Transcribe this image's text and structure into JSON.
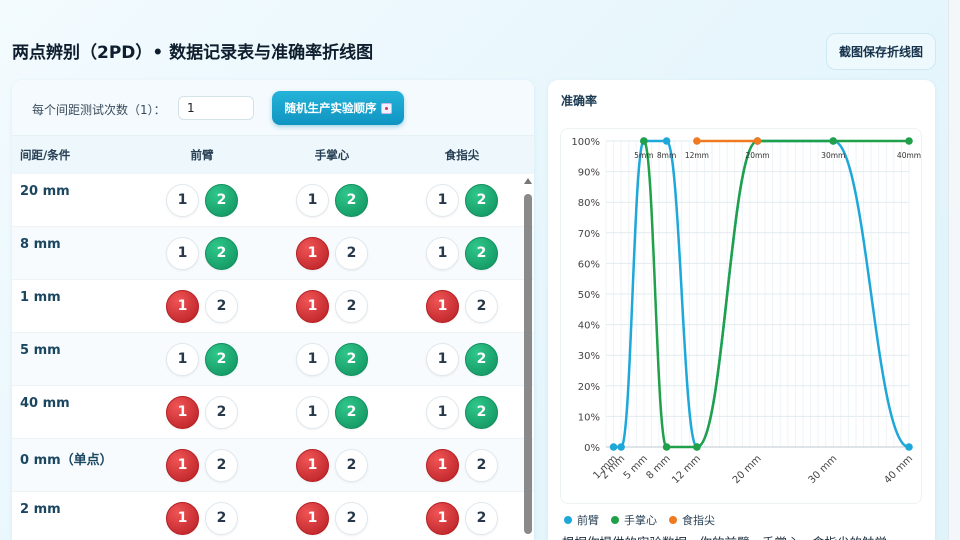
{
  "header": {
    "title": "两点辨别（2PD）• 数据记录表与准确率折线图",
    "save_button": "截图保存折线图"
  },
  "controls": {
    "count_label": "每个间距测试次数（1）：",
    "count_value": "1",
    "random_button": "随机生产实验顺序",
    "random_icon": "dice-icon"
  },
  "table": {
    "headers": [
      "间距/条件",
      "前臂",
      "手掌心",
      "食指尖"
    ],
    "rows": [
      {
        "label": "20 mm",
        "cells": [
          [
            "1",
            "2",
            2
          ],
          [
            "1",
            "2",
            2
          ],
          [
            "1",
            "2",
            2
          ]
        ]
      },
      {
        "label": "8 mm",
        "cells": [
          [
            "1",
            "2",
            2
          ],
          [
            "1",
            "2",
            1
          ],
          [
            "1",
            "2",
            2
          ]
        ]
      },
      {
        "label": "1 mm",
        "cells": [
          [
            "1",
            "2",
            1
          ],
          [
            "1",
            "2",
            1
          ],
          [
            "1",
            "2",
            1
          ]
        ]
      },
      {
        "label": "5 mm",
        "cells": [
          [
            "1",
            "2",
            2
          ],
          [
            "1",
            "2",
            2
          ],
          [
            "1",
            "2",
            2
          ]
        ]
      },
      {
        "label": "40 mm",
        "cells": [
          [
            "1",
            "2",
            1
          ],
          [
            "1",
            "2",
            2
          ],
          [
            "1",
            "2",
            2
          ]
        ]
      },
      {
        "label": "0 mm（单点）",
        "cells": [
          [
            "1",
            "2",
            1
          ],
          [
            "1",
            "2",
            1
          ],
          [
            "1",
            "2",
            1
          ]
        ]
      },
      {
        "label": "2 mm",
        "cells": [
          [
            "1",
            "2",
            1
          ],
          [
            "1",
            "2",
            1
          ],
          [
            "1",
            "2",
            1
          ]
        ]
      }
    ],
    "selection_colors": {
      "correct": "#12a36b",
      "incorrect": "#cf2a2e"
    }
  },
  "chart_panel": {
    "title": "准确率",
    "summary_text": "根据你提供的实验数据，你的前臂、手掌心、食指尖的触觉"
  },
  "chart_data": {
    "type": "line",
    "x": [
      1,
      2,
      5,
      8,
      12,
      20,
      30,
      40
    ],
    "x_tick_labels": [
      "1 mm",
      "2 mm",
      "5 mm",
      "8 mm",
      "12 mm",
      "20 mm",
      "30 mm",
      "40 mm"
    ],
    "ylim": [
      0,
      100
    ],
    "y_tick_labels": [
      "0%",
      "10%",
      "20%",
      "30%",
      "40%",
      "50%",
      "60%",
      "70%",
      "80%",
      "90%",
      "100%"
    ],
    "grid": true,
    "legend_position": "bottom",
    "series": [
      {
        "name": "前臂",
        "color": "#1ea7d9",
        "points": [
          [
            1,
            0
          ],
          [
            2,
            0
          ],
          [
            5,
            100
          ],
          [
            8,
            100
          ],
          [
            12,
            0
          ],
          [
            20,
            100
          ],
          [
            30,
            100
          ],
          [
            40,
            0
          ]
        ],
        "point_labels": [
          "",
          "",
          "5mm",
          "8mm",
          "",
          "20mm",
          "30mm",
          ""
        ]
      },
      {
        "name": "手掌心",
        "color": "#20a04a",
        "points": [
          [
            5,
            100
          ],
          [
            8,
            0
          ],
          [
            12,
            0
          ],
          [
            20,
            100
          ],
          [
            30,
            100
          ],
          [
            40,
            100
          ]
        ],
        "point_labels": [
          "",
          "",
          "",
          "",
          "",
          "40mm"
        ]
      },
      {
        "name": "食指尖",
        "color": "#f07a22",
        "points": [
          [
            12,
            100
          ],
          [
            20,
            100
          ]
        ],
        "point_labels": [
          "12mm",
          ""
        ]
      }
    ]
  }
}
